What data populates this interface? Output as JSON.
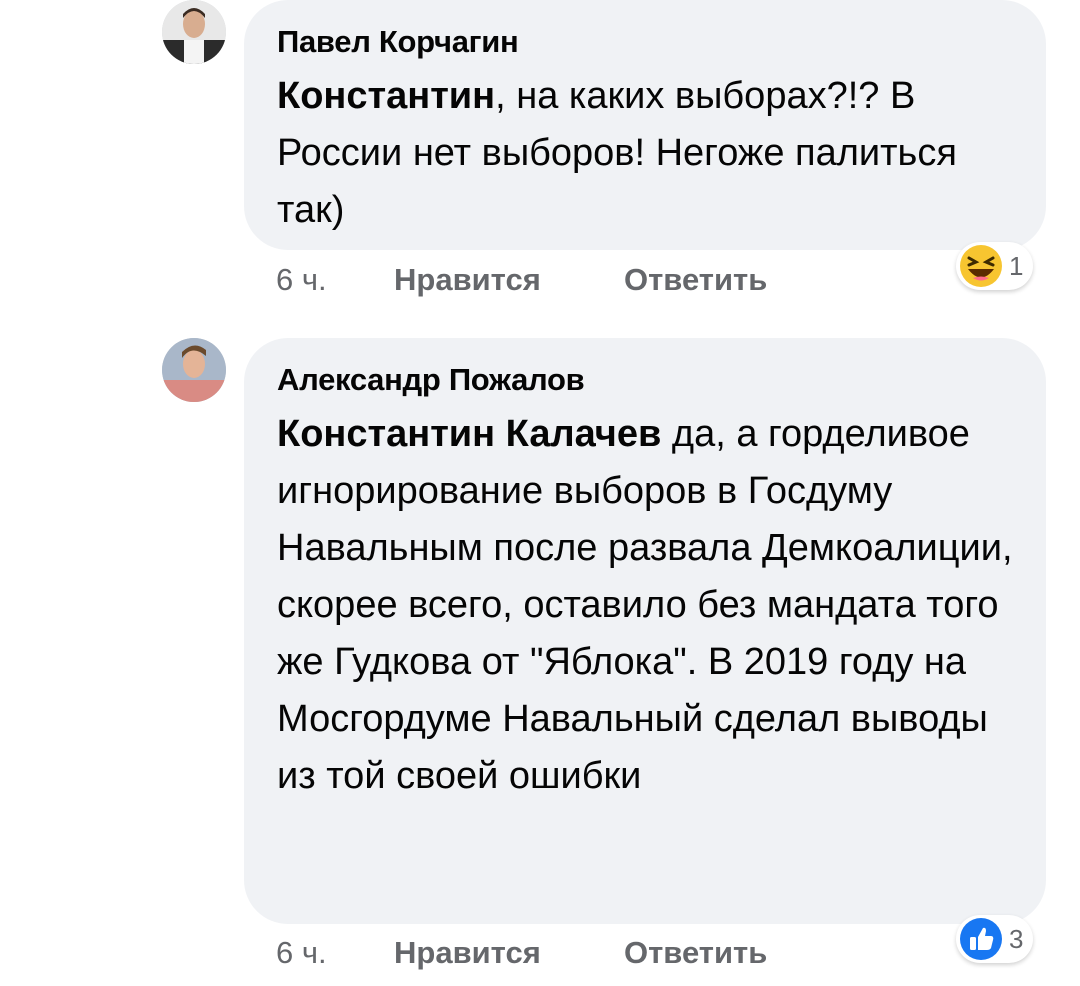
{
  "comments": [
    {
      "author": "Павел Корчагин",
      "mention": "Константин",
      "text": ", на каких выборах?!? В России нет выборов! Негоже палиться так)",
      "time": "6 ч.",
      "like_label": "Нравится",
      "reply_label": "Ответить",
      "reaction": {
        "icon": "haha-emoji-icon",
        "count": "1"
      }
    },
    {
      "author": "Александр Пожалов",
      "mention": "Константин Калачев",
      "text": " да, а горделивое игнорирование выборов в Госдуму Навальным после развала Демкоалиции, скорее всего, оставило без мандата того же Гудкова от \"Яблока\". В 2019 году на Мосгордуме Навальный сделал выводы из той своей ошибки",
      "time": "6 ч.",
      "like_label": "Нравится",
      "reply_label": "Ответить",
      "reaction": {
        "icon": "like-thumb-icon",
        "count": "3"
      }
    }
  ],
  "colors": {
    "bubble": "#f0f2f5",
    "meta_text": "#65676b",
    "like_blue": "#1877f2",
    "haha_yellow": "#f7c530"
  }
}
